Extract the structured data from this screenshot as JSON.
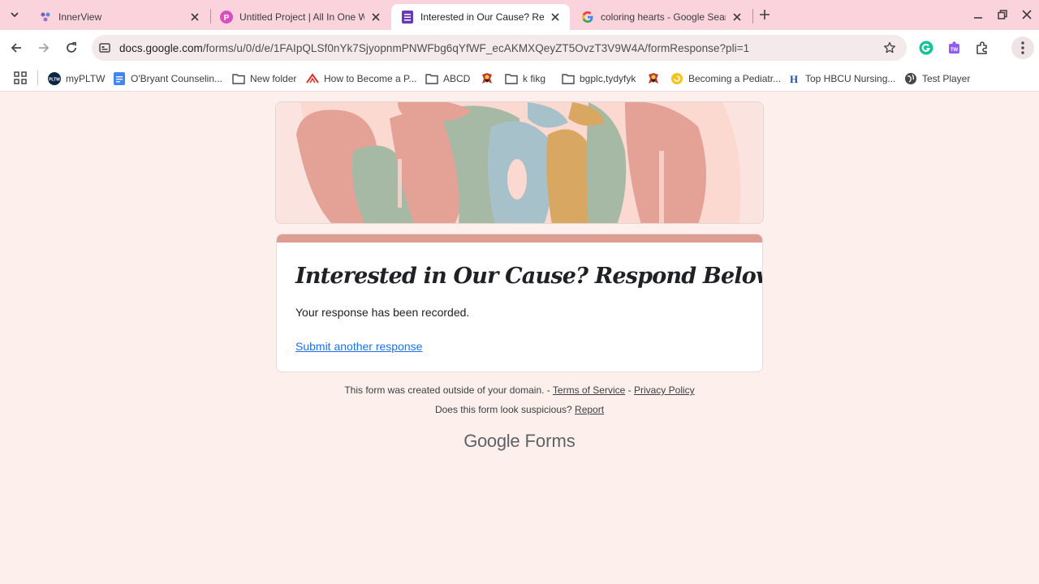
{
  "tabs": [
    {
      "title": "InnerView",
      "active": false
    },
    {
      "title": "Untitled Project | All In One Wel",
      "active": false
    },
    {
      "title": "Interested in Our Cause? Respo",
      "active": true
    },
    {
      "title": "coloring hearts - Google Search",
      "active": false
    }
  ],
  "omnibox": {
    "url_host": "docs.google.com",
    "url_path": "/forms/u/0/d/e/1FAIpQLSf0nYk7SjyopnmPNWFbg6qYfWF_ecAKMXQeyZT5OvzT3V9W4A/formResponse?pli=1"
  },
  "bookmarks": [
    {
      "label": "myPLTW",
      "icon": "pltw-icon"
    },
    {
      "label": "O'Bryant Counselin...",
      "icon": "docs-icon"
    },
    {
      "label": "New folder",
      "icon": "folder-icon"
    },
    {
      "label": "How to Become a P...",
      "icon": "site-icon"
    },
    {
      "label": "ABCD",
      "icon": "folder-icon"
    },
    {
      "label": "",
      "icon": "mascot-icon"
    },
    {
      "label": "k fikg",
      "icon": "folder-icon"
    },
    {
      "label": "bgplc,tydyfyk",
      "icon": "folder-icon"
    },
    {
      "label": "",
      "icon": "mascot-icon"
    },
    {
      "label": "Becoming a Pediatr...",
      "icon": "site-icon"
    },
    {
      "label": "Top HBCU Nursing...",
      "icon": "h-icon"
    },
    {
      "label": "Test Player",
      "icon": "globe-icon"
    }
  ],
  "form": {
    "title": "Interested in Our Cause? Respond Below!",
    "confirmation": "Your response has been recorded.",
    "submit_another": "Submit another response"
  },
  "footer": {
    "domain_notice": "This form was created outside of your domain. -",
    "terms": "Terms of Service",
    "dash": "-",
    "privacy": "Privacy Policy",
    "suspicious": "Does this form look suspicious?",
    "report": "Report",
    "brand_google": "Google",
    "brand_forms": "Forms"
  },
  "colors": {
    "tabstrip": "#fbd3dc",
    "page_bg": "#fcefec",
    "card_accent": "#dd9d91",
    "link": "#1a73e8"
  }
}
